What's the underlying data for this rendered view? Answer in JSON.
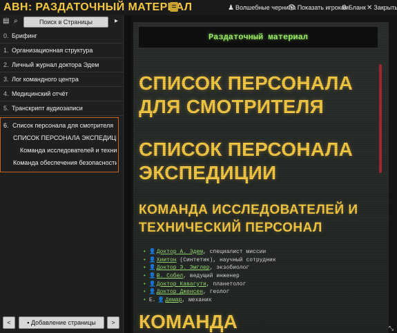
{
  "app": {
    "title": "АВН: РАЗДАТОЧНЫЙ МАТЕРИАЛ",
    "toolbar": [
      {
        "label": "Волшебные чернила",
        "icon": "stamp-icon"
      },
      {
        "label": "Показать игрокам",
        "icon": "eye-icon"
      },
      {
        "label": "Бланк",
        "icon": "gear-icon"
      },
      {
        "label": "Закрыть",
        "icon": "close-icon"
      }
    ]
  },
  "sidebar": {
    "search_placeholder": "Поиск в Страницы",
    "items": [
      {
        "num": "0.",
        "label": "Брифинг"
      },
      {
        "num": "1.",
        "label": "Организационная структура"
      },
      {
        "num": "2.",
        "label": "Личный журнал доктора Эдем"
      },
      {
        "num": "3.",
        "label": "Лог командного центра"
      },
      {
        "num": "4.",
        "label": "Медицинский отчёт"
      },
      {
        "num": "5.",
        "label": "Транскрипт аудиозаписи"
      }
    ],
    "active": {
      "num": "6.",
      "label": "Список персонала для смотрителя",
      "subitems": [
        "СПИСОК ПЕРСОНАЛА ЭКСПЕДИЦИИ",
        "Команда исследователей и технич…",
        "Команда обеспечения безопасности …"
      ]
    },
    "footer": {
      "prev": "<",
      "add": "Добавление страницы",
      "next": ">"
    }
  },
  "document": {
    "header": "Раздаточный материал",
    "title_lines": [
      "СПИСОК ПЕРСОНАЛА",
      "ДЛЯ СМОТРИТЕЛЯ"
    ],
    "subtitle_lines": [
      "СПИСОК ПЕРСОНАЛА",
      "ЭКСПЕДИЦИИ"
    ],
    "section_lines": [
      "КОМАНДА ИССЛЕДОВАТЕЛЕЙ И",
      "ТЕХНИЧЕСКИЙ ПЕРСОНАЛ"
    ],
    "crew": [
      {
        "prefix": "",
        "name": "Доктор А. Эдем",
        "role": ", специалист миссии"
      },
      {
        "prefix": "",
        "name": "Хиитон",
        "role": " (Синтетик), научный сотрудник"
      },
      {
        "prefix": "",
        "name": "Доктор Э. Эмглер",
        "role": ", экзобиолог"
      },
      {
        "prefix": "",
        "name": "В. Собел",
        "role": ", ведущий инженер"
      },
      {
        "prefix": "",
        "name": "Доктор Кавагути",
        "role": ", планетолог"
      },
      {
        "prefix": "",
        "name": "Доктор Дженсен",
        "role": ", геолог"
      },
      {
        "prefix": "Е.",
        "name": "Демар",
        "role": ", механик"
      }
    ],
    "next_heading": "КОМАНДА"
  }
}
